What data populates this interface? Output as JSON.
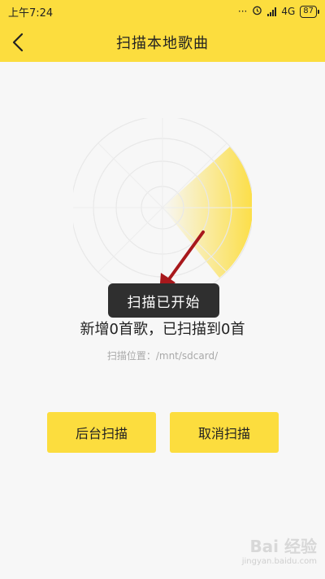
{
  "statusbar": {
    "time": "上午7:24",
    "network": "4G",
    "battery": "87"
  },
  "header": {
    "title": "扫描本地歌曲"
  },
  "toast": {
    "text": "扫描已开始"
  },
  "scan": {
    "summary": "新增0首歌，已扫描到0首",
    "location": "扫描位置：/mnt/sdcard/"
  },
  "buttons": {
    "background_scan": "后台扫描",
    "cancel_scan": "取消扫描"
  },
  "watermark": {
    "logo": "Bai 经验",
    "url": "jingyan.baidu.com"
  },
  "colors": {
    "accent": "#fcdd3e",
    "toast_bg": "#2f2f2f",
    "annotation_arrow": "#a8181c"
  },
  "icons": {
    "back": "chevron-left-icon",
    "alarm": "alarm-icon",
    "signal": "signal-icon"
  }
}
